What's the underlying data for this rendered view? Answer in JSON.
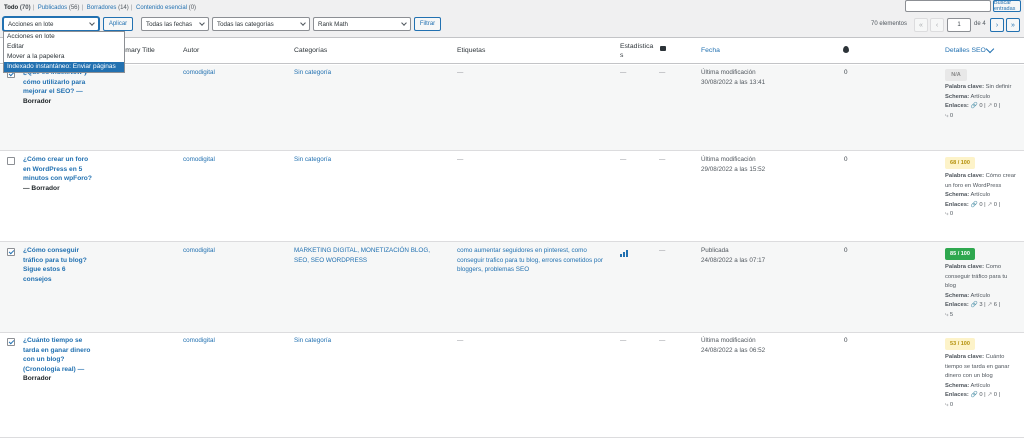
{
  "filters": {
    "views": [
      {
        "label": "Todo",
        "count": "(70)",
        "current": true
      },
      {
        "label": "Publicados",
        "count": "(56)"
      },
      {
        "label": "Borradores",
        "count": "(14)"
      },
      {
        "label": "Contenido esencial",
        "count": "(0)"
      }
    ],
    "search_button": "Buscar entradas",
    "bulk_select": "Acciones en lote",
    "apply_button": "Aplicar",
    "dates_select": "Todas las fechas",
    "categories_select": "Todas las categorías",
    "seo_select": "Rank Math",
    "filter_button": "Filtrar"
  },
  "bulk_menu": [
    "Acciones en lote",
    "Editar",
    "Mover a la papelera",
    "Indexado instantáneo: Enviar páginas"
  ],
  "pagination": {
    "count": "70 elementos",
    "first": "«",
    "prev": "‹",
    "current_page": "1",
    "of": "de 4",
    "next": "›",
    "last": "»"
  },
  "columns": {
    "title": "Primary Title",
    "author": "Autor",
    "categories": "Categorías",
    "tags": "Etiquetas",
    "stats": "Estadística s",
    "date": "Fecha",
    "seo": "Detalles SEO"
  },
  "rows": [
    {
      "checked": true,
      "title": "¿Qué es IndexNow y cómo utilizarlo para mejorar el SEO? —",
      "state": "Borrador",
      "author": "comodigital",
      "categories": "Sin categoría",
      "tags": "—",
      "stats": "—",
      "comments": "—",
      "date_label": "Última modificación",
      "date": "30/08/2022 a las 13:41",
      "links_count": "0",
      "seo_score": "N/A",
      "keyword_label": "Palabra clave:",
      "keyword": "Sin definir",
      "schema_label": "Schema:",
      "schema": "Artículo",
      "links_label": "Enlaces:",
      "internal": "0",
      "external": "0",
      "incoming": "0"
    },
    {
      "checked": false,
      "title": "¿Cómo crear un foro en WordPress en 5 minutos con wpForo?",
      "state": "— Borrador",
      "author": "comodigital",
      "categories": "Sin categoría",
      "tags": "—",
      "stats": "—",
      "comments": "—",
      "date_label": "Última modificación",
      "date": "29/08/2022 a las 15:52",
      "links_count": "0",
      "seo_score": "68 / 100",
      "keyword_label": "Palabra clave:",
      "keyword": "Cómo crear un foro en WordPress",
      "schema_label": "Schema:",
      "schema": "Artículo",
      "links_label": "Enlaces:",
      "internal": "0",
      "external": "0",
      "incoming": "0"
    },
    {
      "checked": true,
      "title": "¿Cómo conseguir tráfico para tu blog? Sigue estos 6 consejos",
      "state": "",
      "author": "comodigital",
      "categories": "MARKETING DIGITAL, MONETIZACIÓN BLOG, SEO, SEO WORDPRESS",
      "tags": "como aumentar seguidores en pinterest, como conseguir trafico para tu blog, errores cometidos por bloggers, problemas SEO",
      "stats": "",
      "comments": "—",
      "date_label": "Publicada",
      "date": "24/08/2022 a las 07:17",
      "links_count": "0",
      "seo_score": "85 / 100",
      "keyword_label": "Palabra clave:",
      "keyword": "Como conseguir tráfico para tu blog",
      "schema_label": "Schema:",
      "schema": "Artículo",
      "links_label": "Enlaces:",
      "internal": "3",
      "external": "6",
      "incoming": "5"
    },
    {
      "checked": true,
      "title": "¿Cuánto tiempo se tarda en ganar dinero con un blog? (Cronología real) —",
      "state": "Borrador",
      "author": "comodigital",
      "categories": "Sin categoría",
      "tags": "—",
      "stats": "—",
      "comments": "—",
      "date_label": "Última modificación",
      "date": "24/08/2022 a las 06:52",
      "links_count": "0",
      "seo_score": "53 / 100",
      "keyword_label": "Palabra clave:",
      "keyword": "Cuánto tiempo se tarda en ganar dinero con un blog",
      "schema_label": "Schema:",
      "schema": "Artículo",
      "links_label": "Enlaces:",
      "internal": "0",
      "external": "0",
      "incoming": "0"
    }
  ]
}
